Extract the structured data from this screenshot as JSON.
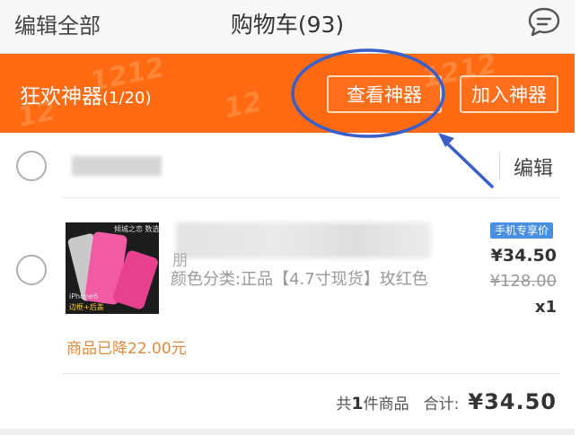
{
  "header": {
    "edit_all": "编辑全部",
    "title": "购物车(93)",
    "message_icon": "message-bubble-icon"
  },
  "promo": {
    "label": "狂欢神器",
    "count": "(1/20)",
    "view_button": "查看神器",
    "add_button": "加入神器",
    "background_color": "#ff6a12"
  },
  "shop": {
    "edit_label": "编辑"
  },
  "item": {
    "thumbnail": {
      "badge": "倾城之恋 数选一天",
      "model": "iPhone6",
      "tag": "边框+后盖"
    },
    "title_visible": "朋",
    "spec": "颜色分类:正品【4.7寸现货】玫红色",
    "price_tag": "手机专享价",
    "price": "¥34.50",
    "original_price": "¥128.00",
    "quantity": "x1",
    "reduced_note": "商品已降22.00元"
  },
  "summary": {
    "count_prefix": "共",
    "count": "1",
    "count_suffix": "件商品",
    "total_label": "合计:",
    "total": "¥34.50"
  },
  "colors": {
    "accent_orange": "#ff6a12",
    "annotation_blue": "#3a5fc8",
    "price_tag_blue": "#4a90e2"
  }
}
